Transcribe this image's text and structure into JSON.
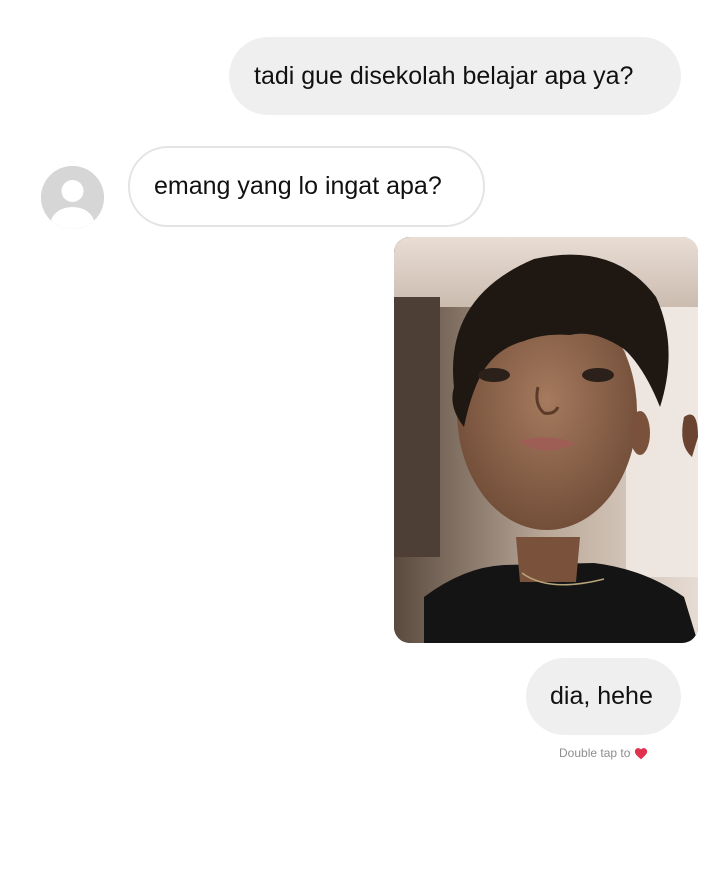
{
  "conversation": {
    "messages": [
      {
        "sender": "me",
        "type": "text",
        "text": "tadi gue disekolah belajar apa ya?"
      },
      {
        "sender": "contact",
        "type": "text",
        "text": "emang yang lo ingat apa?"
      },
      {
        "sender": "me",
        "type": "photo",
        "icon": "selfie-photo"
      },
      {
        "sender": "me",
        "type": "text",
        "text": "dia, hehe"
      }
    ],
    "reaction_hint": {
      "text": "Double tap to",
      "icon": "heart-icon",
      "icon_color": "#e0324f"
    }
  },
  "avatar": {
    "icon": "default-profile-avatar"
  },
  "colors": {
    "background": "#ffffff",
    "outgoing_bubble": "#efefef",
    "incoming_bubble_border": "#e4e4e4",
    "text": "#111111",
    "hint_text": "#8e8e8e"
  }
}
